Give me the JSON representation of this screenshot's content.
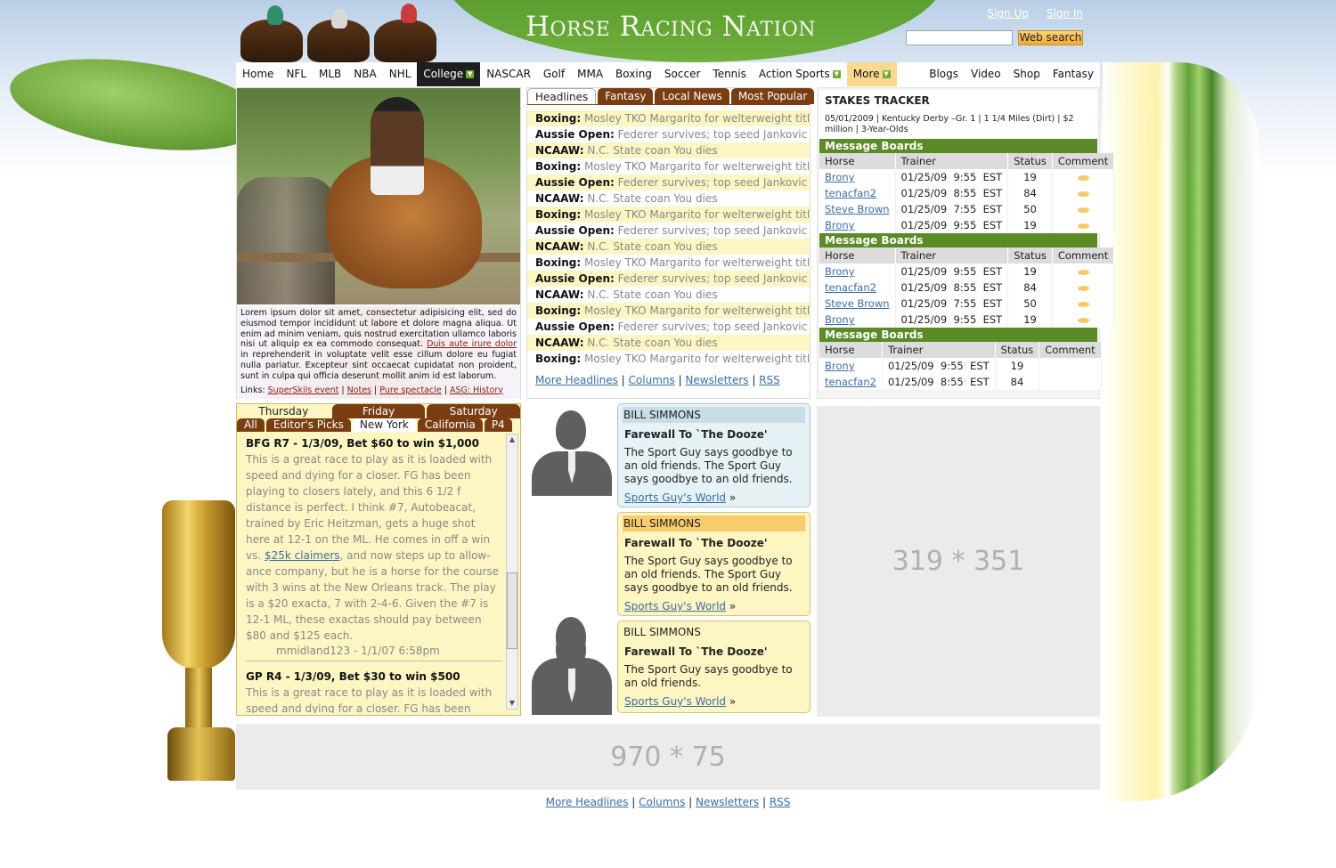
{
  "header": {
    "logo": "Horse Racing Nation",
    "sign_up": "Sign Up",
    "sign_in": "Sign In",
    "search_placeholder": "",
    "search_button": "Web search"
  },
  "nav": {
    "left": [
      "Home",
      "NFL",
      "MLB",
      "NBA",
      "NHL",
      "College",
      "NASCAR",
      "Golf",
      "MMA",
      "Boxing",
      "Soccer",
      "Tennis",
      "Action Sports",
      "More"
    ],
    "right": [
      "Blogs",
      "Video",
      "Shop",
      "Fantasy"
    ],
    "active": "College"
  },
  "feature": {
    "caption": "Lorem ipsum dolor sit amet, consectetur adipisicing elit, sed do eiusmod tempor incididunt ut labore et dolore magna aliqua. Ut enim ad minim veniam, quis nostrud exercitation ullamco laboris nisi ut aliquip ex ea commodo consequat.",
    "caption_link": "Duis aute irure dolor",
    "caption_tail": "in reprehenderit in voluptate velit esse cillum dolore eu fugiat nulla pariatur. Excepteur sint occaecat cupidatat non proident, sunt in culpa qui officia deserunt mollit anim id est laborum.",
    "links_label": "Links:",
    "links": [
      "SuperSkils event",
      "Notes",
      "Pure spectacle",
      "ASG: History"
    ]
  },
  "headlines": {
    "tabs": [
      "Headlines",
      "Fantasy",
      "Local News",
      "Most Popular"
    ],
    "items": [
      {
        "tag": "Boxing:",
        "text": "Mosley TKO Margarito for welterweight title"
      },
      {
        "tag": "Aussie Open:",
        "text": "Federer survives; top seed Jankovic out"
      },
      {
        "tag": "NCAAW:",
        "text": "N.C. State coan You dies"
      },
      {
        "tag": "Boxing:",
        "text": "Mosley TKO Margarito for welterweight title"
      },
      {
        "tag": "Aussie Open:",
        "text": "Federer survives; top seed Jankovic out"
      },
      {
        "tag": "NCAAW:",
        "text": "N.C. State coan You dies"
      },
      {
        "tag": "Boxing:",
        "text": "Mosley TKO Margarito for welterweight title"
      },
      {
        "tag": "Aussie Open:",
        "text": "Federer survives; top seed Jankovic out"
      },
      {
        "tag": "NCAAW:",
        "text": "N.C. State coan You dies"
      },
      {
        "tag": "Boxing:",
        "text": "Mosley TKO Margarito for welterweight title"
      },
      {
        "tag": "Aussie Open:",
        "text": "Federer survives; top seed Jankovic out"
      },
      {
        "tag": "NCAAW:",
        "text": "N.C. State coan You dies"
      },
      {
        "tag": "Boxing:",
        "text": "Mosley TKO Margarito for welterweight title"
      },
      {
        "tag": "Aussie Open:",
        "text": "Federer survives; top seed Jankovic out"
      },
      {
        "tag": "NCAAW:",
        "text": "N.C. State coan You dies"
      },
      {
        "tag": "Boxing:",
        "text": "Mosley TKO Margarito for welterweight title"
      }
    ],
    "footer_links": [
      "More Headlines",
      "Columns",
      "Newsletters",
      "RSS"
    ]
  },
  "stakes": {
    "title": "STAKES TRACKER",
    "info": "05/01/2009 | Kentucky Derby –Gr. 1 | 1 1/4 Miles (Dirt) | $2 million | 3-Year-Olds",
    "board_title": "Message Boards",
    "columns": [
      "Horse",
      "Trainer",
      "Status",
      "Comment"
    ],
    "boards": [
      [
        {
          "horse": "Brony",
          "trainer": "01/25/09  9:55  EST",
          "status": "19"
        },
        {
          "horse": "tenacfan2",
          "trainer": "01/25/09  8:55  EST",
          "status": "84"
        },
        {
          "horse": "Steve Brown",
          "trainer": "01/25/09  7:55  EST",
          "status": "50"
        },
        {
          "horse": "Brony",
          "trainer": "01/25/09  9:55  EST",
          "status": "19"
        }
      ],
      [
        {
          "horse": "Brony",
          "trainer": "01/25/09  9:55  EST",
          "status": "19"
        },
        {
          "horse": "tenacfan2",
          "trainer": "01/25/09  8:55  EST",
          "status": "84"
        },
        {
          "horse": "Steve Brown",
          "trainer": "01/25/09  7:55  EST",
          "status": "50"
        },
        {
          "horse": "Brony",
          "trainer": "01/25/09  9:55  EST",
          "status": "19"
        }
      ],
      [
        {
          "horse": "Brony",
          "trainer": "01/25/09  9:55  EST",
          "status": "19"
        },
        {
          "horse": "tenacfan2",
          "trainer": "01/25/09  8:55  EST",
          "status": "84"
        }
      ]
    ],
    "comment_icons": [
      [
        true,
        true,
        true,
        true
      ],
      [
        true,
        true,
        true,
        true
      ],
      [
        false,
        false
      ]
    ]
  },
  "picks": {
    "days": [
      "Thursday",
      "Friday",
      "Saturday"
    ],
    "regions": [
      "All",
      "Editor's Picks",
      "New York",
      "California",
      "P4"
    ],
    "active_day": "Thursday",
    "active_region": "New York",
    "entries": [
      {
        "title": "BFG R7 - 1/3/09, Bet $60 to win $1,000",
        "text_before": "This is a great race to play as it is loaded with speed and dying for a closer.  FG has been playing to closers lately, and this 6 1/2 f distance is perfect.  I think #7, Autobeacat, trained by Eric Heitzman, gets a huge shot here at 12-1 on the ML.  He comes in off a win vs.",
        "link": "$25k claimers",
        "text_after": ", and now steps up to allow-ance company, but he is a horse for the course with 3 wins at the New Orleans track.   The play is a $20 exacta, 7 with 2-4-6.  Given the  #7 is 12-1 ML, these exactas should pay between $80 and $125 each.",
        "meta": "mmidland123 - 1/1/07 6:58pm"
      },
      {
        "title": "GP R4 - 1/3/09, Bet $30 to win $500",
        "text_before": "This is a great race to play as it is loaded with speed and dying for a closer.  FG has been playing to",
        "link": "",
        "text_after": "",
        "meta": ""
      }
    ]
  },
  "columnists": [
    {
      "name": "BILL SIMMONS",
      "title": "Farewall To `The Dooze'",
      "text": "The Sport Guy says goodbye to an old friends. The Sport Guy says goodbye to an old friends.",
      "link": "Sports Guy's  World",
      "arrow": "»"
    },
    {
      "name": "BILL SIMMONS",
      "title": "Farewall To `The Dooze'",
      "text": "The Sport Guy says goodbye to an old friends. The Sport Guy says goodbye to an old friends.",
      "link": "Sports Guy's  World",
      "arrow": "»"
    },
    {
      "name": "BILL SIMMONS",
      "title": "Farewall To `The Dooze'",
      "text": "The Sport Guy says goodbye to an old friends.",
      "link": "Sports Guy's  World",
      "arrow": "»"
    }
  ],
  "ads": {
    "right": "319 * 351",
    "bottom": "970 * 75"
  },
  "footer": {
    "links": [
      "More Headlines",
      "Columns",
      "Newsletters",
      "RSS"
    ]
  },
  "colors": {
    "brown_tab": "#7a3d12",
    "green_header": "#5b8a26",
    "yellow_bg": "#fdf6c3",
    "link": "#3a6ea5"
  }
}
